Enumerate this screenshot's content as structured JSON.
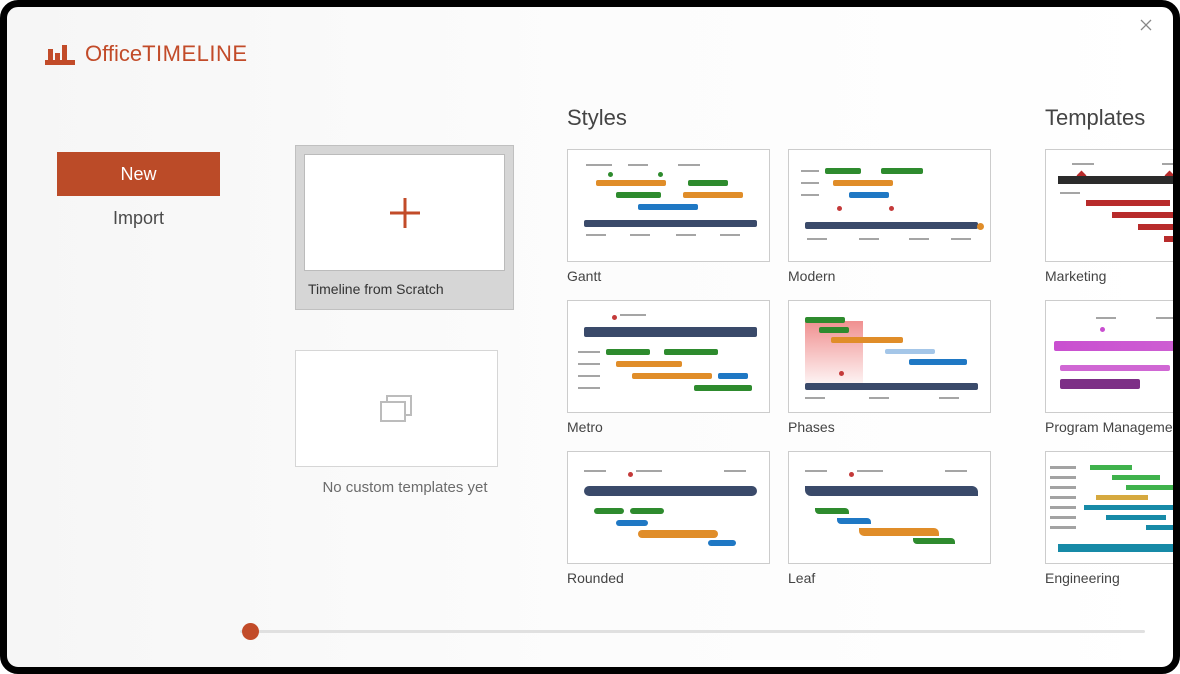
{
  "brand": {
    "office": "Office",
    "timeline": "TIMELINE"
  },
  "nav": {
    "new": "New",
    "import": "Import"
  },
  "scratch": {
    "caption": "Timeline from Scratch"
  },
  "empty": {
    "caption": "No custom templates yet"
  },
  "sections": {
    "styles": "Styles",
    "templates": "Templates"
  },
  "styles": {
    "gantt": "Gantt",
    "modern": "Modern",
    "metro": "Metro",
    "phases": "Phases",
    "rounded": "Rounded",
    "leaf": "Leaf"
  },
  "templates": {
    "marketing": "Marketing",
    "program_mgmt": "Program Management",
    "engineering": "Engineering"
  }
}
